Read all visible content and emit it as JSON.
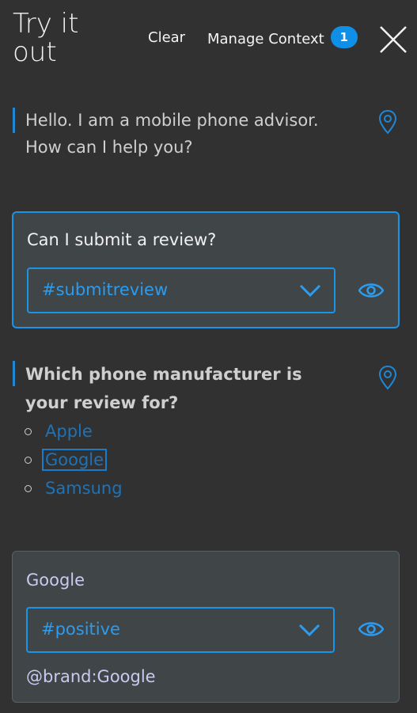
{
  "header": {
    "title": "Try it out",
    "clear_label": "Clear",
    "manage_context_label": "Manage Context",
    "context_count": "1"
  },
  "messages": [
    {
      "type": "bot",
      "text": "Hello. I am a mobile phone advisor. How can I help you?"
    },
    {
      "type": "user",
      "text": "Can I submit a review?",
      "intent": "#submitreview"
    },
    {
      "type": "bot",
      "text": "Which phone manufacturer is your review for?",
      "options": [
        "Apple",
        "Google",
        "Samsung"
      ],
      "selected_option": "Google"
    },
    {
      "type": "user",
      "text": "Google",
      "intent": "#positive",
      "entity": "@brand:Google"
    }
  ],
  "colors": {
    "background": "#313131",
    "card": "#404547",
    "accent": "#1a94e8",
    "link": "#1e73b8",
    "badge": "#0f8fe6"
  }
}
